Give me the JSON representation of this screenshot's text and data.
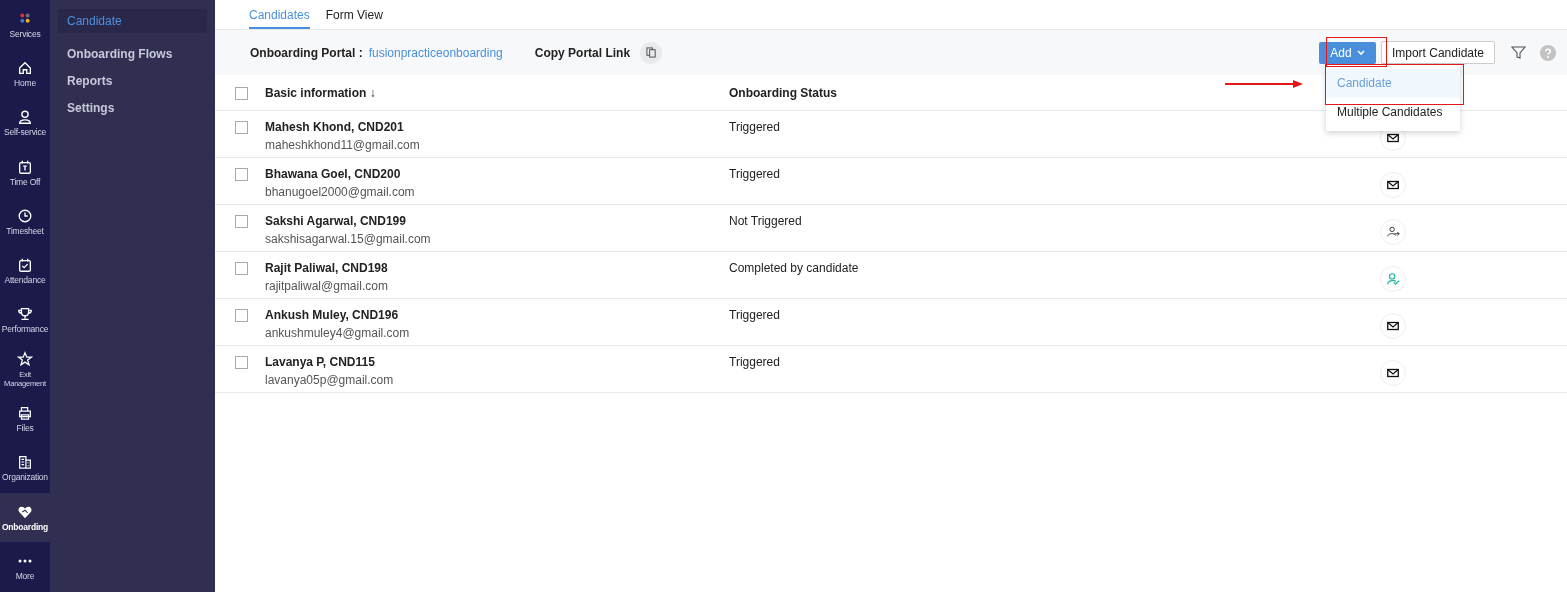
{
  "rail": [
    {
      "label": "Services",
      "selected": false
    },
    {
      "label": "Home",
      "selected": false
    },
    {
      "label": "Self-service",
      "selected": false
    },
    {
      "label": "Time Off",
      "selected": false
    },
    {
      "label": "Timesheet",
      "selected": false
    },
    {
      "label": "Attendance",
      "selected": false
    },
    {
      "label": "Performance",
      "selected": false
    },
    {
      "label": "Exit Management",
      "selected": false
    },
    {
      "label": "Files",
      "selected": false
    },
    {
      "label": "Organization",
      "selected": false
    },
    {
      "label": "Onboarding",
      "selected": true
    },
    {
      "label": "More",
      "selected": false
    }
  ],
  "sidebar": {
    "items": [
      {
        "label": "Candidate",
        "selected": true
      },
      {
        "label": "Onboarding Flows",
        "selected": false
      },
      {
        "label": "Reports",
        "selected": false
      },
      {
        "label": "Settings",
        "selected": false
      }
    ]
  },
  "tabs": [
    {
      "label": "Candidates",
      "selected": true
    },
    {
      "label": "Form View",
      "selected": false
    }
  ],
  "portal": {
    "label": "Onboarding Portal :",
    "link": "fusionpracticeonboarding",
    "copy_label": "Copy Portal Link"
  },
  "toolbar": {
    "add_button": "Add",
    "import_button": "Import Candidate"
  },
  "add_menu": {
    "items": [
      {
        "label": "Candidate",
        "selected": true
      },
      {
        "label": "Multiple Candidates",
        "selected": false
      }
    ]
  },
  "table": {
    "select_all_checked": false,
    "columns": [
      "Basic information ↓",
      "Onboarding Status"
    ],
    "rows": [
      {
        "name": "Mahesh Khond, CND201",
        "email": "maheshkhond11@gmail.com",
        "status": "Triggered",
        "kind": "mail",
        "checked": false
      },
      {
        "name": "Bhawana Goel, CND200",
        "email": "bhanugoel2000@gmail.com",
        "status": "Triggered",
        "kind": "mail",
        "checked": false
      },
      {
        "name": "Sakshi Agarwal, CND199",
        "email": "sakshisagarwal.15@gmail.com",
        "status": "Not Triggered",
        "kind": "invite",
        "checked": false
      },
      {
        "name": "Rajit Paliwal, CND198",
        "email": "rajitpaliwal@gmail.com",
        "status": "Completed by candidate",
        "kind": "completed",
        "checked": false
      },
      {
        "name": "Ankush Muley, CND196",
        "email": "ankushmuley4@gmail.com",
        "status": "Triggered",
        "kind": "mail",
        "checked": false
      },
      {
        "name": "Lavanya P, CND115",
        "email": "lavanya05p@gmail.com",
        "status": "Triggered",
        "kind": "mail",
        "checked": false
      }
    ]
  }
}
